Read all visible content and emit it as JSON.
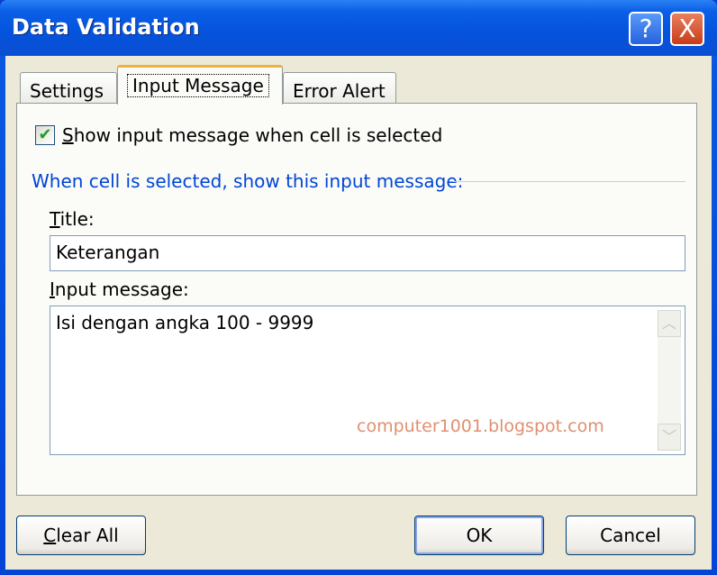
{
  "window": {
    "title": "Data Validation",
    "help_icon": "?",
    "close_icon": "X"
  },
  "tabs": [
    {
      "label": "Settings"
    },
    {
      "label": "Input Message",
      "active": true
    },
    {
      "label": "Error Alert"
    }
  ],
  "show_checkbox": {
    "label": "Show input message when cell is selected",
    "checked": true
  },
  "group_label": "When cell is selected, show this input message:",
  "title_field": {
    "label": "Title:",
    "value": "Keterangan"
  },
  "message_field": {
    "label": "Input message:",
    "value": "Isi dengan angka 100 - 9999"
  },
  "watermark": "computer1001.blogspot.com",
  "buttons": {
    "clear_all": "Clear All",
    "ok": "OK",
    "cancel": "Cancel"
  },
  "colors": {
    "title_bar": "#0552dc",
    "group_label": "#0046d5",
    "dialog_bg": "#ece9d8"
  }
}
